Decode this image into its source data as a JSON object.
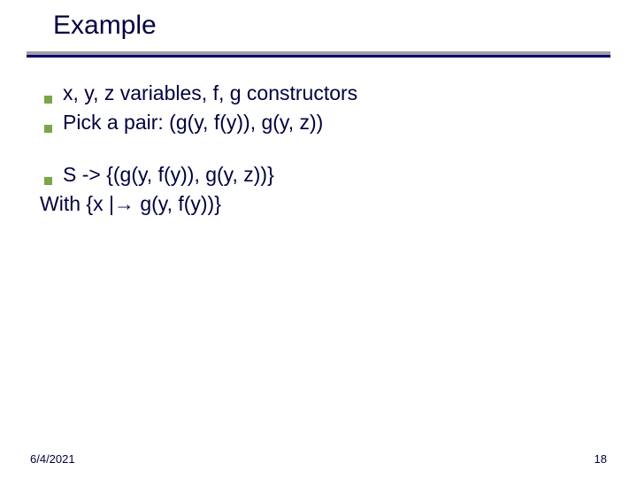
{
  "title": "Example",
  "bullets_top": [
    "x, y, z variables, f, g constructors",
    "Pick a pair: (g(y, f(y)), g(y, z))"
  ],
  "bullet_mid": "S ->  {(g(y, f(y)), g(y, z))}",
  "line_plain": "With {x |→ g(y, f(y))}",
  "footer": {
    "date": "6/4/2021",
    "page": "18"
  }
}
